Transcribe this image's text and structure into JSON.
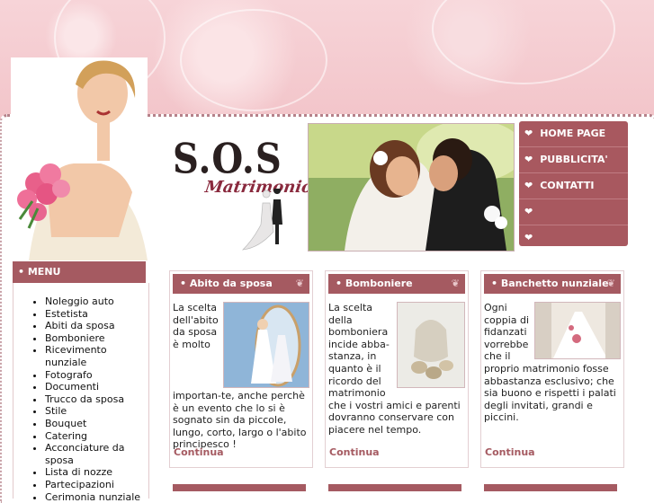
{
  "brand": {
    "logo_text": "S.O.S",
    "logo_subtext": "Matrimonio"
  },
  "topnav": [
    {
      "label": "HOME PAGE"
    },
    {
      "label": "PUBBLICITA'"
    },
    {
      "label": "CONTATTI"
    },
    {
      "label": ""
    },
    {
      "label": ""
    }
  ],
  "menu": {
    "title": "• MENU",
    "items": [
      "Noleggio auto",
      "Estetista",
      "Abiti da sposa",
      "Bomboniere",
      "Ricevimento nunziale",
      "Fotografo",
      "Documenti",
      "Trucco da sposa",
      "Stile",
      "Bouquet",
      "Catering",
      "Acconciature da sposa",
      "Lista di nozze",
      "Partecipazioni",
      "Cerimonia nunziale"
    ]
  },
  "boxes": [
    {
      "title": "• Abito da sposa",
      "text": "La scelta dell'abito da sposa è molto importan-te, anche perchè è un evento che lo si è sognato sin da piccole, lungo, corto, largo o l'abito principesco !",
      "link": "Continua"
    },
    {
      "title": "• Bomboniere",
      "text": "La scelta della bomboniera incide abba-stanza, in quanto è il ricordo del matrimonio che i vostri amici e parenti dovranno conservare con piacere nel tempo.",
      "link": "Continua"
    },
    {
      "title": "• Banchetto nunziale",
      "text": "Ogni coppia di fidanzati vorrebbe che il proprio matrimonio fosse abbastanza esclusivo; che sia buono e rispetti i palati degli invitati, grandi e piccini.",
      "link": "Continua"
    }
  ],
  "colors": {
    "accent": "#a55a61",
    "background": "#f4cfd3"
  }
}
